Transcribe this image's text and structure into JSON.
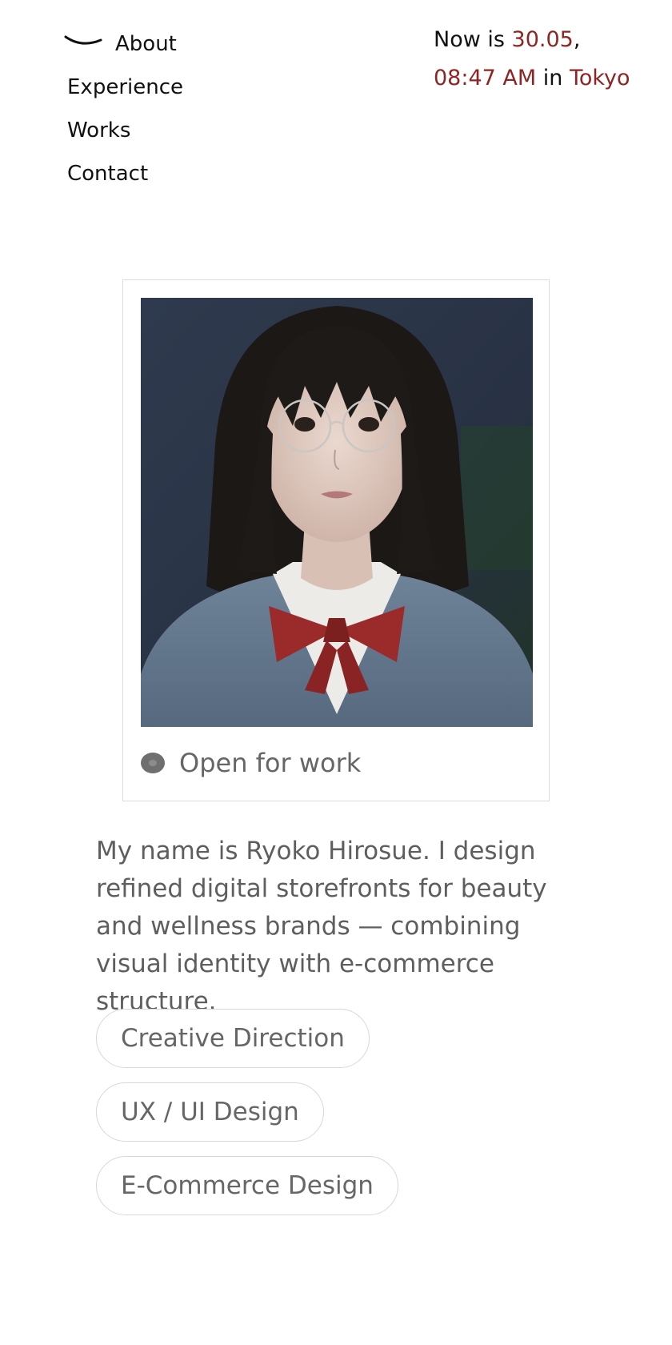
{
  "nav": {
    "items": [
      {
        "label": "About"
      },
      {
        "label": "Experience"
      },
      {
        "label": "Works"
      },
      {
        "label": "Contact"
      }
    ]
  },
  "clock": {
    "prefix": "Now is ",
    "date": "30.05",
    "comma": ",",
    "time": "08:47 AM",
    "in_word": " in ",
    "city": "Tokyo"
  },
  "profile": {
    "status": "Open for work",
    "bio": "My name is Ryoko Hirosue. I design refined digital storefronts for beauty and wellness brands — combining visual identity with e-commerce structure.",
    "tags": [
      "Creative Direction",
      "UX / UI Design",
      "E-Commerce Design"
    ]
  },
  "colors": {
    "accent": "#8f2424",
    "text": "#111111",
    "muted": "#5e5e5e",
    "border": "#dcdcdc"
  }
}
